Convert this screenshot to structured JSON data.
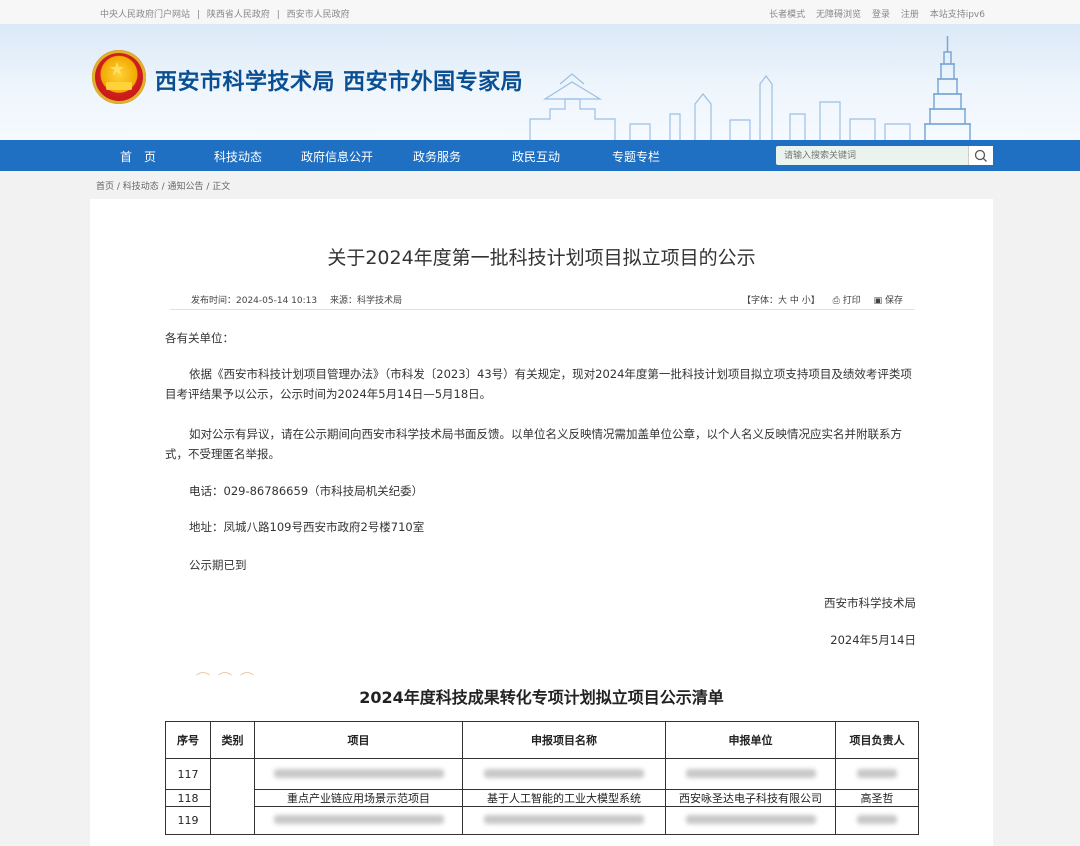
{
  "topbar": {
    "links": [
      "中央人民政府门户网站",
      "|",
      "陕西省人民政府",
      "|",
      "西安市人民政府"
    ],
    "right": [
      "长者模式",
      "无障碍浏览",
      "登录",
      "注册",
      "本站支持ipv6"
    ]
  },
  "header": {
    "site_title": "西安市科学技术局  西安市外国专家局"
  },
  "nav": {
    "items": [
      "首　页",
      "科技动态",
      "政府信息公开",
      "政务服务",
      "政民互动",
      "专题专栏"
    ],
    "search_placeholder": "请输入搜索关键词"
  },
  "breadcrumb": "首页 / 科技动态 / 通知公告 / 正文",
  "article": {
    "title": "关于2024年度第一批科技计划项目拟立项目的公示",
    "publish_time": "发布时间：2024-05-14 10:13",
    "source": "来源：科学技术局",
    "font_size": "【字体：大 中 小】",
    "print": "打印",
    "save": "保存",
    "greeting": "各有关单位：",
    "para1": "依据《西安市科技计划项目管理办法》（市科发〔2023〕43号）有关规定，现对2024年度第一批科技计划项目拟立项支持项目及绩效考评类项目考评结果予以公示，公示时间为2024年5月14日—5月18日。",
    "para2": "如对公示有异议，请在公示期间向西安市科学技术局书面反馈。以单位名义反映情况需加盖单位公章，以个人名义反映情况应实名并附联系方式，不受理匿名举报。",
    "phone": "电话：029-86786659（市科技局机关纪委）",
    "address": "地址：凤城八路109号西安市政府2号楼710室",
    "ended": "公示期已到",
    "signature": "西安市科学技术局",
    "date": "2024年5月14日"
  },
  "list": {
    "title": "2024年度科技成果转化专项计划拟立项目公示清单",
    "headers": [
      "序号",
      "类别",
      "项目",
      "申报项目名称",
      "申报单位",
      "项目负责人"
    ],
    "rows": [
      {
        "no": "117"
      },
      {
        "no": "118",
        "project": "重点产业链应用场景示范项目",
        "name": "基于人工智能的工业大模型系统",
        "unit": "西安咏圣达电子科技有限公司",
        "leader": "高圣哲"
      },
      {
        "no": "119"
      }
    ]
  },
  "colors": {
    "nav": "#1f6fc2",
    "title": "#0a4f93"
  }
}
